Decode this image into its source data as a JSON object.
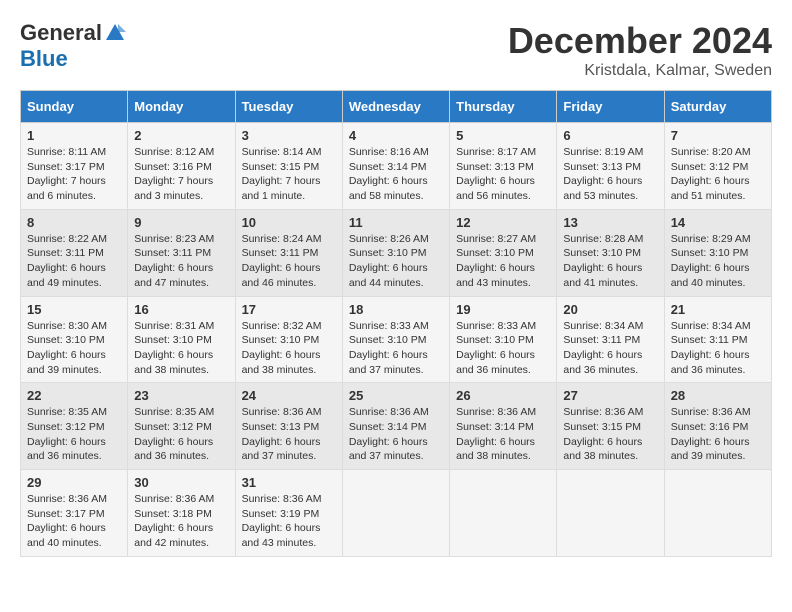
{
  "logo": {
    "general": "General",
    "blue": "Blue"
  },
  "title": "December 2024",
  "location": "Kristdala, Kalmar, Sweden",
  "headers": [
    "Sunday",
    "Monday",
    "Tuesday",
    "Wednesday",
    "Thursday",
    "Friday",
    "Saturday"
  ],
  "weeks": [
    [
      {
        "day": "1",
        "sunrise": "Sunrise: 8:11 AM",
        "sunset": "Sunset: 3:17 PM",
        "daylight": "Daylight: 7 hours and 6 minutes."
      },
      {
        "day": "2",
        "sunrise": "Sunrise: 8:12 AM",
        "sunset": "Sunset: 3:16 PM",
        "daylight": "Daylight: 7 hours and 3 minutes."
      },
      {
        "day": "3",
        "sunrise": "Sunrise: 8:14 AM",
        "sunset": "Sunset: 3:15 PM",
        "daylight": "Daylight: 7 hours and 1 minute."
      },
      {
        "day": "4",
        "sunrise": "Sunrise: 8:16 AM",
        "sunset": "Sunset: 3:14 PM",
        "daylight": "Daylight: 6 hours and 58 minutes."
      },
      {
        "day": "5",
        "sunrise": "Sunrise: 8:17 AM",
        "sunset": "Sunset: 3:13 PM",
        "daylight": "Daylight: 6 hours and 56 minutes."
      },
      {
        "day": "6",
        "sunrise": "Sunrise: 8:19 AM",
        "sunset": "Sunset: 3:13 PM",
        "daylight": "Daylight: 6 hours and 53 minutes."
      },
      {
        "day": "7",
        "sunrise": "Sunrise: 8:20 AM",
        "sunset": "Sunset: 3:12 PM",
        "daylight": "Daylight: 6 hours and 51 minutes."
      }
    ],
    [
      {
        "day": "8",
        "sunrise": "Sunrise: 8:22 AM",
        "sunset": "Sunset: 3:11 PM",
        "daylight": "Daylight: 6 hours and 49 minutes."
      },
      {
        "day": "9",
        "sunrise": "Sunrise: 8:23 AM",
        "sunset": "Sunset: 3:11 PM",
        "daylight": "Daylight: 6 hours and 47 minutes."
      },
      {
        "day": "10",
        "sunrise": "Sunrise: 8:24 AM",
        "sunset": "Sunset: 3:11 PM",
        "daylight": "Daylight: 6 hours and 46 minutes."
      },
      {
        "day": "11",
        "sunrise": "Sunrise: 8:26 AM",
        "sunset": "Sunset: 3:10 PM",
        "daylight": "Daylight: 6 hours and 44 minutes."
      },
      {
        "day": "12",
        "sunrise": "Sunrise: 8:27 AM",
        "sunset": "Sunset: 3:10 PM",
        "daylight": "Daylight: 6 hours and 43 minutes."
      },
      {
        "day": "13",
        "sunrise": "Sunrise: 8:28 AM",
        "sunset": "Sunset: 3:10 PM",
        "daylight": "Daylight: 6 hours and 41 minutes."
      },
      {
        "day": "14",
        "sunrise": "Sunrise: 8:29 AM",
        "sunset": "Sunset: 3:10 PM",
        "daylight": "Daylight: 6 hours and 40 minutes."
      }
    ],
    [
      {
        "day": "15",
        "sunrise": "Sunrise: 8:30 AM",
        "sunset": "Sunset: 3:10 PM",
        "daylight": "Daylight: 6 hours and 39 minutes."
      },
      {
        "day": "16",
        "sunrise": "Sunrise: 8:31 AM",
        "sunset": "Sunset: 3:10 PM",
        "daylight": "Daylight: 6 hours and 38 minutes."
      },
      {
        "day": "17",
        "sunrise": "Sunrise: 8:32 AM",
        "sunset": "Sunset: 3:10 PM",
        "daylight": "Daylight: 6 hours and 38 minutes."
      },
      {
        "day": "18",
        "sunrise": "Sunrise: 8:33 AM",
        "sunset": "Sunset: 3:10 PM",
        "daylight": "Daylight: 6 hours and 37 minutes."
      },
      {
        "day": "19",
        "sunrise": "Sunrise: 8:33 AM",
        "sunset": "Sunset: 3:10 PM",
        "daylight": "Daylight: 6 hours and 36 minutes."
      },
      {
        "day": "20",
        "sunrise": "Sunrise: 8:34 AM",
        "sunset": "Sunset: 3:11 PM",
        "daylight": "Daylight: 6 hours and 36 minutes."
      },
      {
        "day": "21",
        "sunrise": "Sunrise: 8:34 AM",
        "sunset": "Sunset: 3:11 PM",
        "daylight": "Daylight: 6 hours and 36 minutes."
      }
    ],
    [
      {
        "day": "22",
        "sunrise": "Sunrise: 8:35 AM",
        "sunset": "Sunset: 3:12 PM",
        "daylight": "Daylight: 6 hours and 36 minutes."
      },
      {
        "day": "23",
        "sunrise": "Sunrise: 8:35 AM",
        "sunset": "Sunset: 3:12 PM",
        "daylight": "Daylight: 6 hours and 36 minutes."
      },
      {
        "day": "24",
        "sunrise": "Sunrise: 8:36 AM",
        "sunset": "Sunset: 3:13 PM",
        "daylight": "Daylight: 6 hours and 37 minutes."
      },
      {
        "day": "25",
        "sunrise": "Sunrise: 8:36 AM",
        "sunset": "Sunset: 3:14 PM",
        "daylight": "Daylight: 6 hours and 37 minutes."
      },
      {
        "day": "26",
        "sunrise": "Sunrise: 8:36 AM",
        "sunset": "Sunset: 3:14 PM",
        "daylight": "Daylight: 6 hours and 38 minutes."
      },
      {
        "day": "27",
        "sunrise": "Sunrise: 8:36 AM",
        "sunset": "Sunset: 3:15 PM",
        "daylight": "Daylight: 6 hours and 38 minutes."
      },
      {
        "day": "28",
        "sunrise": "Sunrise: 8:36 AM",
        "sunset": "Sunset: 3:16 PM",
        "daylight": "Daylight: 6 hours and 39 minutes."
      }
    ],
    [
      {
        "day": "29",
        "sunrise": "Sunrise: 8:36 AM",
        "sunset": "Sunset: 3:17 PM",
        "daylight": "Daylight: 6 hours and 40 minutes."
      },
      {
        "day": "30",
        "sunrise": "Sunrise: 8:36 AM",
        "sunset": "Sunset: 3:18 PM",
        "daylight": "Daylight: 6 hours and 42 minutes."
      },
      {
        "day": "31",
        "sunrise": "Sunrise: 8:36 AM",
        "sunset": "Sunset: 3:19 PM",
        "daylight": "Daylight: 6 hours and 43 minutes."
      },
      null,
      null,
      null,
      null
    ]
  ]
}
